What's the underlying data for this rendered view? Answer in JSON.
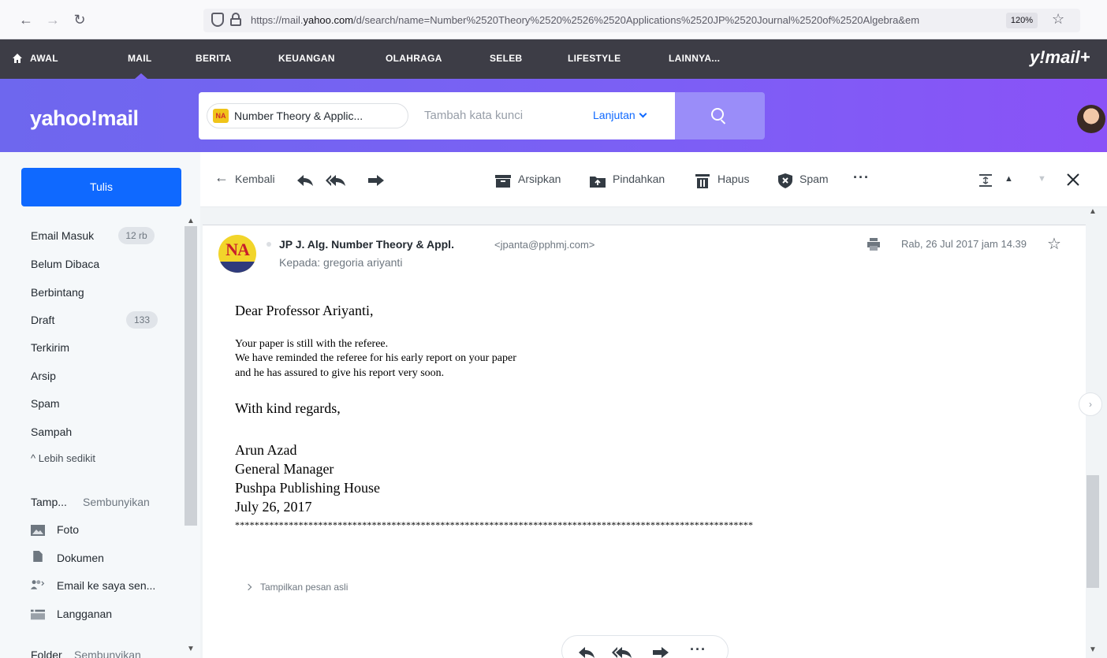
{
  "browser": {
    "url_prefix": "https://mail.",
    "url_domain": "yahoo.com",
    "url_rest": "/d/search/name=Number%2520Theory%2520%2526%2520Applications%2520JP%2520Journal%2520of%2520Algebra&em",
    "zoom": "120%"
  },
  "topnav": {
    "items": [
      "AWAL",
      "MAIL",
      "BERITA",
      "KEUANGAN",
      "OLAHRAGA",
      "SELEB",
      "LIFESTYLE",
      "LAINNYA..."
    ],
    "brand": "y!mail+"
  },
  "header": {
    "logo": "yahoo!mail",
    "search_chip_label": "Number Theory & Applic...",
    "search_chip_avatar": "NA",
    "search_placeholder": "Tambah kata kunci",
    "advanced_label": "Lanjutan"
  },
  "sidebar": {
    "compose_label": "Tulis",
    "folders": [
      {
        "label": "Email Masuk",
        "count": "12 rb"
      },
      {
        "label": "Belum Dibaca",
        "count": ""
      },
      {
        "label": "Berbintang",
        "count": ""
      },
      {
        "label": "Draft",
        "count": "133"
      },
      {
        "label": "Terkirim",
        "count": ""
      },
      {
        "label": "Arsip",
        "count": ""
      },
      {
        "label": "Spam",
        "count": ""
      },
      {
        "label": "Sampah",
        "count": ""
      }
    ],
    "less_label": "^ Lebih sedikit",
    "views_title": "Tamp...",
    "views_hide": "Sembunyikan",
    "views": [
      {
        "label": "Foto",
        "icon": "photo-icon"
      },
      {
        "label": "Dokumen",
        "icon": "document-icon"
      },
      {
        "label": "Email ke saya sen...",
        "icon": "people-icon"
      },
      {
        "label": "Langganan",
        "icon": "subscriptions-icon"
      }
    ],
    "folders_title": "Folder",
    "folders_hide": "Sembunyikan"
  },
  "toolbar": {
    "back_label": "Kembali",
    "archive_label": "Arsipkan",
    "move_label": "Pindahkan",
    "delete_label": "Hapus",
    "spam_label": "Spam"
  },
  "message": {
    "sender_name": "JP J. Alg. Number Theory & Appl.",
    "sender_email": "<jpanta@pphmj.com>",
    "to_line": "Kepada: gregoria ariyanti",
    "date": "Rab, 26 Jul 2017 jam 14.39",
    "greeting": "Dear Professor Ariyanti,",
    "body_lines": [
      "Your paper is still with the referee.",
      "We have reminded the referee for his early report on your paper",
      "and he has assured to give his report very soon."
    ],
    "closing": "With kind regards,",
    "signature": [
      "Arun Azad",
      "General Manager",
      "Pushpa Publishing House",
      "July 26, 2017"
    ],
    "stars": "**********************************************************************************************************",
    "show_original": "Tampilkan pesan asli"
  }
}
